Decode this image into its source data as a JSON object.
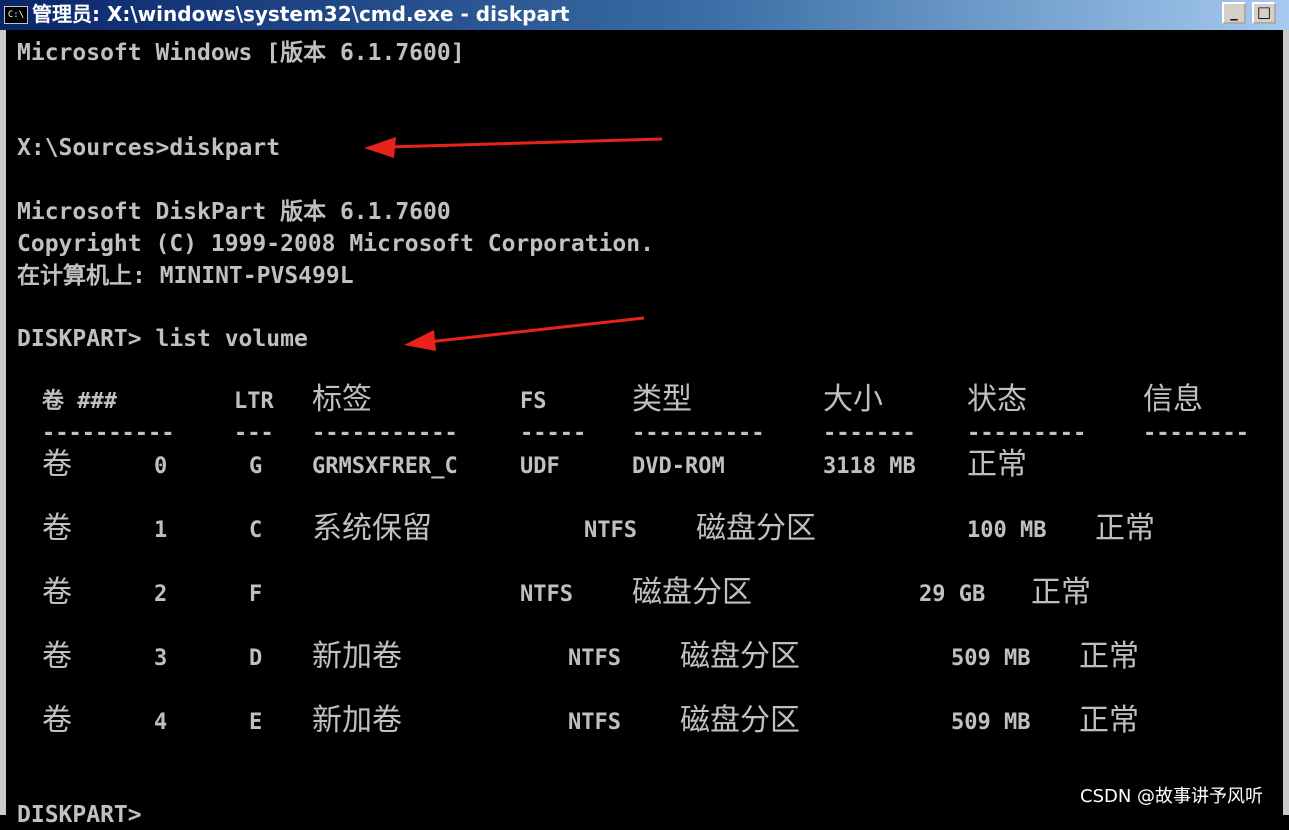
{
  "window": {
    "title": "管理员: X:\\windows\\system32\\cmd.exe - diskpart",
    "icon": "cmd-icon",
    "min_label": "_",
    "max_label": "□"
  },
  "console": {
    "lines": {
      "banner": "Microsoft Windows [版本 6.1.7600]",
      "prompt1": "X:\\Sources>diskpart",
      "dp_name": "Microsoft DiskPart 版本 6.1.7600",
      "dp_copyright": "Copyright (C) 1999-2008 Microsoft Corporation.",
      "dp_computer": "在计算机上: MININT-PVS499L",
      "prompt2": "DISKPART> list volume",
      "prompt3": "DISKPART>"
    },
    "table": {
      "headers": {
        "vol": "卷 ###",
        "ltr": "LTR",
        "label": "标签",
        "fs": "FS",
        "type": "类型",
        "size": "大小",
        "status": "状态",
        "info": "信息"
      },
      "separators": {
        "vol": "----------",
        "ltr": "---",
        "label": "-----------",
        "fs": "-----",
        "type": "----------",
        "size": "-------",
        "status": "---------",
        "info": "--------"
      },
      "rows": [
        {
          "vol": "卷",
          "num": "0",
          "ltr": "G",
          "label": "GRMSXFRER_C",
          "fs": "UDF",
          "type": "DVD-ROM",
          "size": "3118 MB",
          "status": "正常"
        },
        {
          "vol": "卷",
          "num": "1",
          "ltr": "C",
          "label": "系统保留",
          "fs": "NTFS",
          "type": "磁盘分区",
          "size": "100 MB",
          "status": "正常"
        },
        {
          "vol": "卷",
          "num": "2",
          "ltr": "F",
          "label": "",
          "fs": "NTFS",
          "type": "磁盘分区",
          "size": "29 GB",
          "status": "正常"
        },
        {
          "vol": "卷",
          "num": "3",
          "ltr": "D",
          "label": "新加卷",
          "fs": "NTFS",
          "type": "磁盘分区",
          "size": "509 MB",
          "status": "正常"
        },
        {
          "vol": "卷",
          "num": "4",
          "ltr": "E",
          "label": "新加卷",
          "fs": "NTFS",
          "type": "磁盘分区",
          "size": "509 MB",
          "status": "正常"
        }
      ]
    }
  },
  "annotations": {
    "arrow_color": "#e8231b"
  },
  "watermark": "CSDN @故事讲予风听"
}
